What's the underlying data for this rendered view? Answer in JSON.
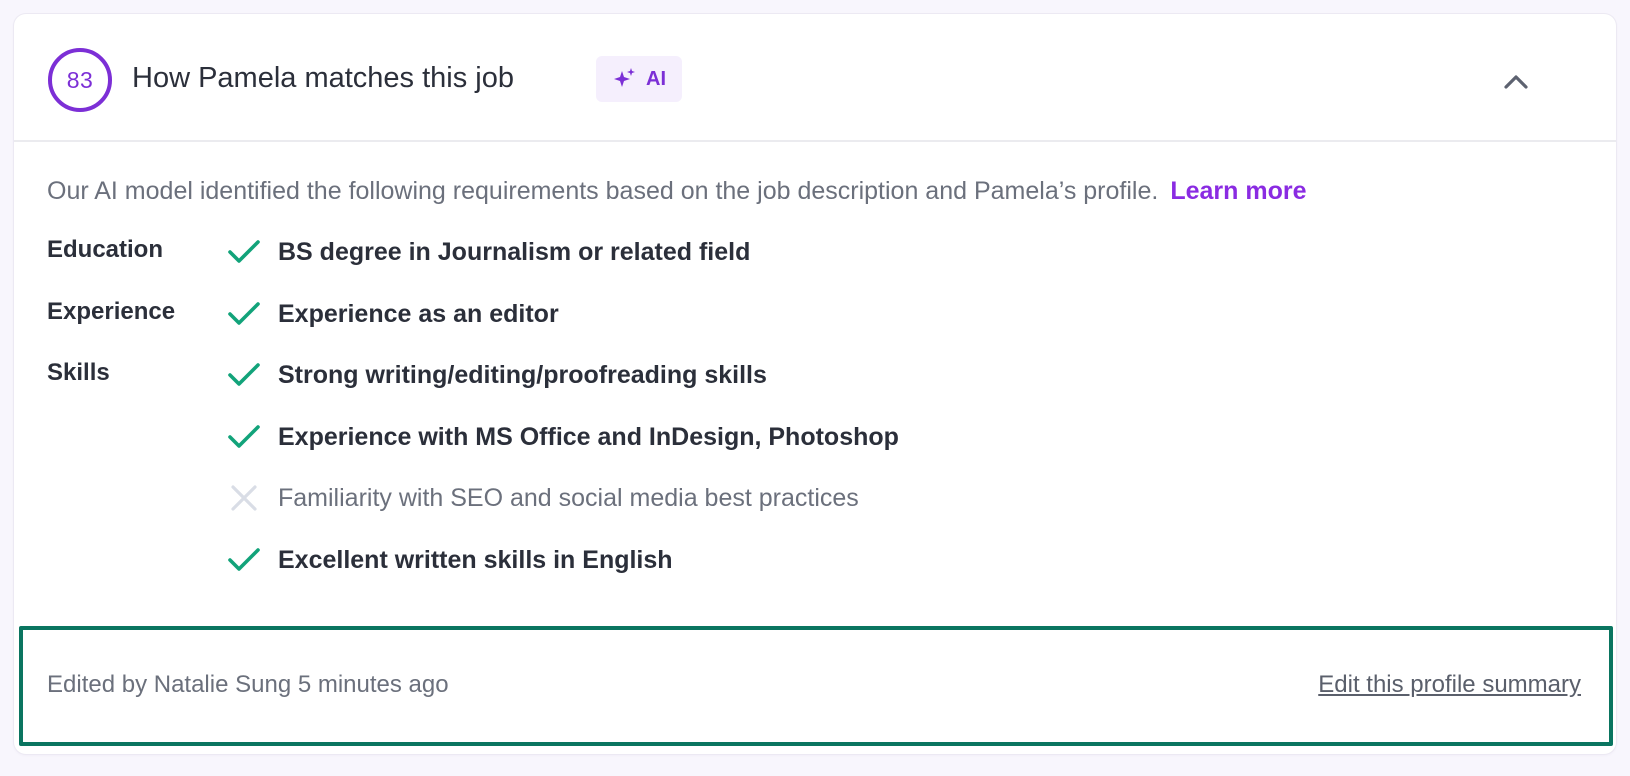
{
  "header": {
    "score": "83",
    "title": "How Pamela matches this job",
    "ai_badge_label": "AI",
    "collapse_icon": "chevron-up-icon"
  },
  "intro": {
    "text": "Our AI model identified the following requirements based on the job description and Pamela’s profile.",
    "link_label": "Learn more"
  },
  "categories": [
    "Education",
    "Experience",
    "Skills"
  ],
  "requirements": [
    {
      "text": "BS degree in Journalism or related field",
      "met": true
    },
    {
      "text": "Experience as an editor",
      "met": true
    },
    {
      "text": "Strong writing/editing/proofreading skills",
      "met": true
    },
    {
      "text": "Experience with MS Office and InDesign, Photoshop",
      "met": true
    },
    {
      "text": "Familiarity with SEO and social media best practices",
      "met": false
    },
    {
      "text": "Excellent written skills in English",
      "met": true
    }
  ],
  "footer": {
    "edited_text": "Edited by Natalie Sung 5 minutes ago",
    "edit_link_label": "Edit this profile summary"
  },
  "colors": {
    "accent": "#7c2fd6",
    "check": "#12a37a",
    "cross": "#d9dde6",
    "footer_border": "#0a7560"
  }
}
